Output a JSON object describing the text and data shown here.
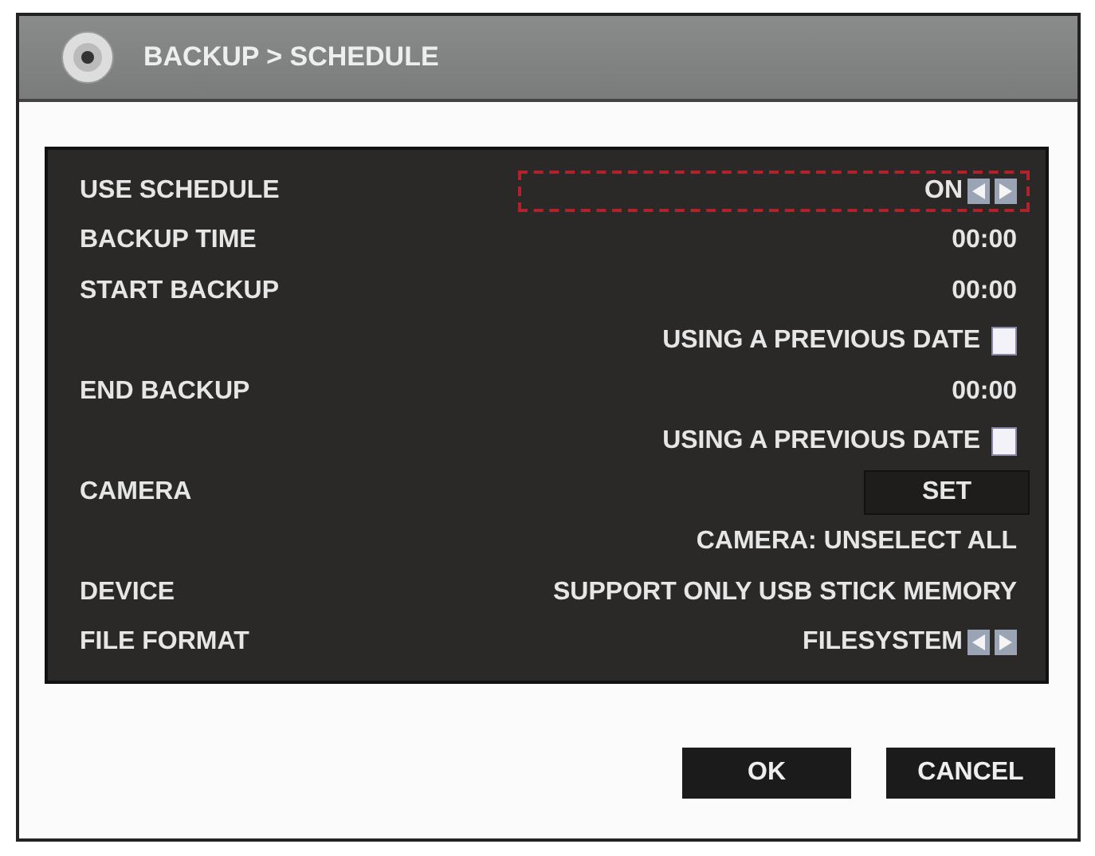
{
  "window": {
    "title": "BACKUP > SCHEDULE"
  },
  "rows": [
    {
      "label": "USE SCHEDULE",
      "kind": "spinner",
      "value": "ON",
      "focused": true
    },
    {
      "label": "BACKUP TIME",
      "kind": "text",
      "value": "00:00",
      "focused": false
    },
    {
      "label": "START BACKUP",
      "kind": "text",
      "value": "00:00",
      "focused": false
    },
    {
      "kind": "checkbox",
      "value": "USING A PREVIOUS DATE",
      "checked": false,
      "focused": false
    },
    {
      "label": "END BACKUP",
      "kind": "text",
      "value": "00:00",
      "focused": false
    },
    {
      "kind": "checkbox",
      "value": "USING A PREVIOUS DATE",
      "checked": false,
      "focused": false
    },
    {
      "label": "CAMERA",
      "kind": "button",
      "value": "SET",
      "focused": false
    },
    {
      "kind": "text",
      "value": "CAMERA: UNSELECT ALL",
      "focused": false
    },
    {
      "label": "DEVICE",
      "kind": "text",
      "value": "SUPPORT ONLY USB STICK MEMORY",
      "focused": false
    },
    {
      "label": "FILE FORMAT",
      "kind": "spinner",
      "value": "FILESYSTEM",
      "focused": false
    }
  ],
  "buttons": [
    "OK",
    "CANCEL"
  ]
}
